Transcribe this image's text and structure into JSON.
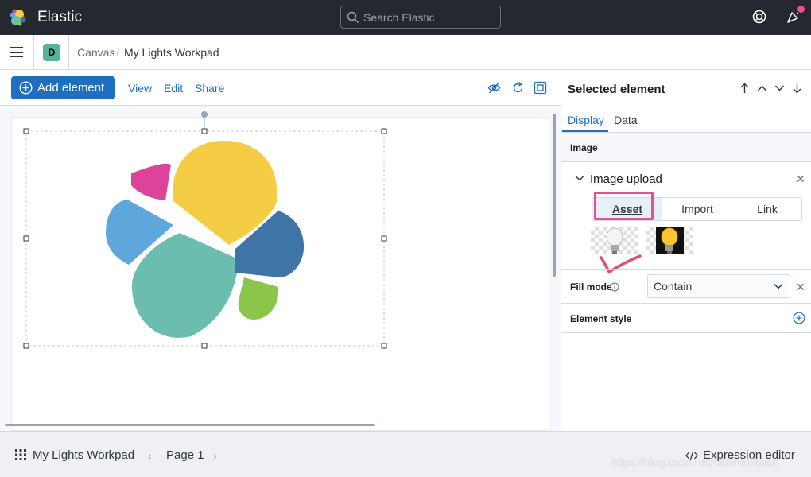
{
  "header": {
    "brand": "Elastic",
    "search_placeholder": "Search Elastic"
  },
  "breadcrumb": {
    "space": "D",
    "parent": "Canvas",
    "separator": "/",
    "current": "My Lights Workpad"
  },
  "toolbar": {
    "add_element": "Add element",
    "view": "View",
    "edit": "Edit",
    "share": "Share"
  },
  "panel": {
    "title": "Selected element",
    "tabs": [
      {
        "label": "Display"
      },
      {
        "label": "Data"
      }
    ],
    "section_image": "Image",
    "image_upload": {
      "title": "Image upload",
      "options": [
        "Asset",
        "Import",
        "Link"
      ],
      "selected": "Asset"
    },
    "fill_mode": {
      "label": "Fill mode",
      "value": "Contain"
    },
    "element_style": "Element style"
  },
  "footer": {
    "workpad_name": "My Lights Workpad",
    "page": "Page 1",
    "expression_editor": "Expression editor",
    "watermark": "https://blog.csdn.net/UbuntuTouch"
  },
  "colors": {
    "accent": "#1e6fc0",
    "highlight": "#e7508e",
    "space_badge": "#54b399",
    "logo_yellow": "#f4cd45",
    "logo_teal": "#6bbeaf",
    "logo_blue": "#5ea7dd",
    "logo_navy": "#3f75a6",
    "logo_pink": "#db4499",
    "logo_green": "#8bc64a"
  }
}
